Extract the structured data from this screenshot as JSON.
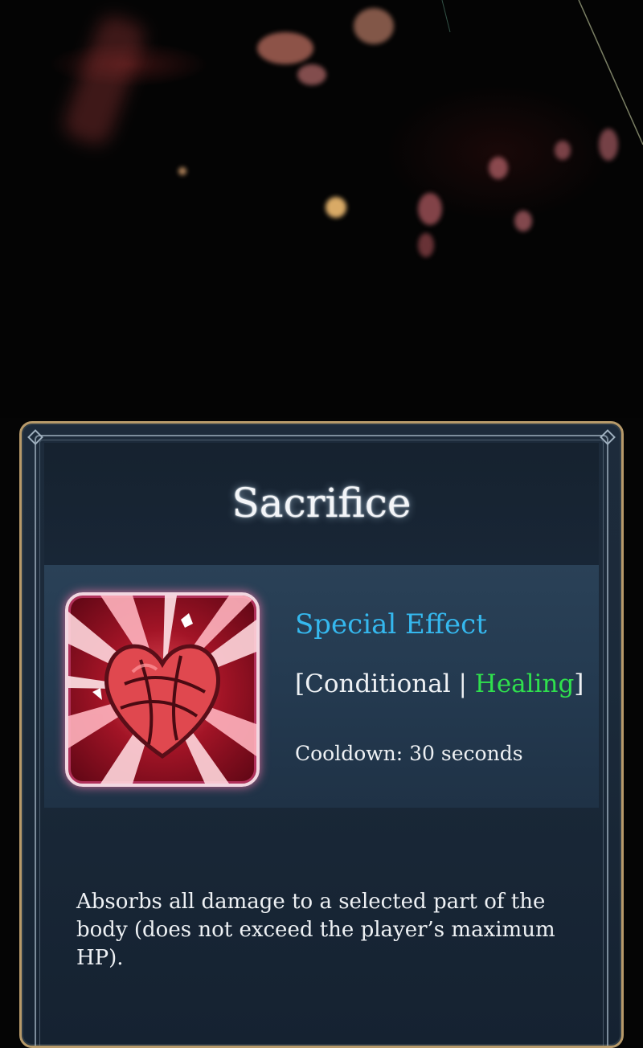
{
  "skill": {
    "name": "Sacrifice",
    "icon": "sacrifice-heart-icon",
    "effect_type": "Special Effect",
    "tag_open": "[",
    "tag_condition": "Conditional",
    "tag_separator": " | ",
    "tag_healing": "Healing",
    "tag_close": "]",
    "cooldown": "Cooldown: 30 seconds",
    "description": "Absorbs all damage to a selected part of the body (does not exceed the player’s maximum HP)."
  },
  "colors": {
    "card_border": "#b79a6a",
    "effect_title": "#35b8ee",
    "healing_tag": "#2fe04d",
    "text": "#eef1f4"
  }
}
